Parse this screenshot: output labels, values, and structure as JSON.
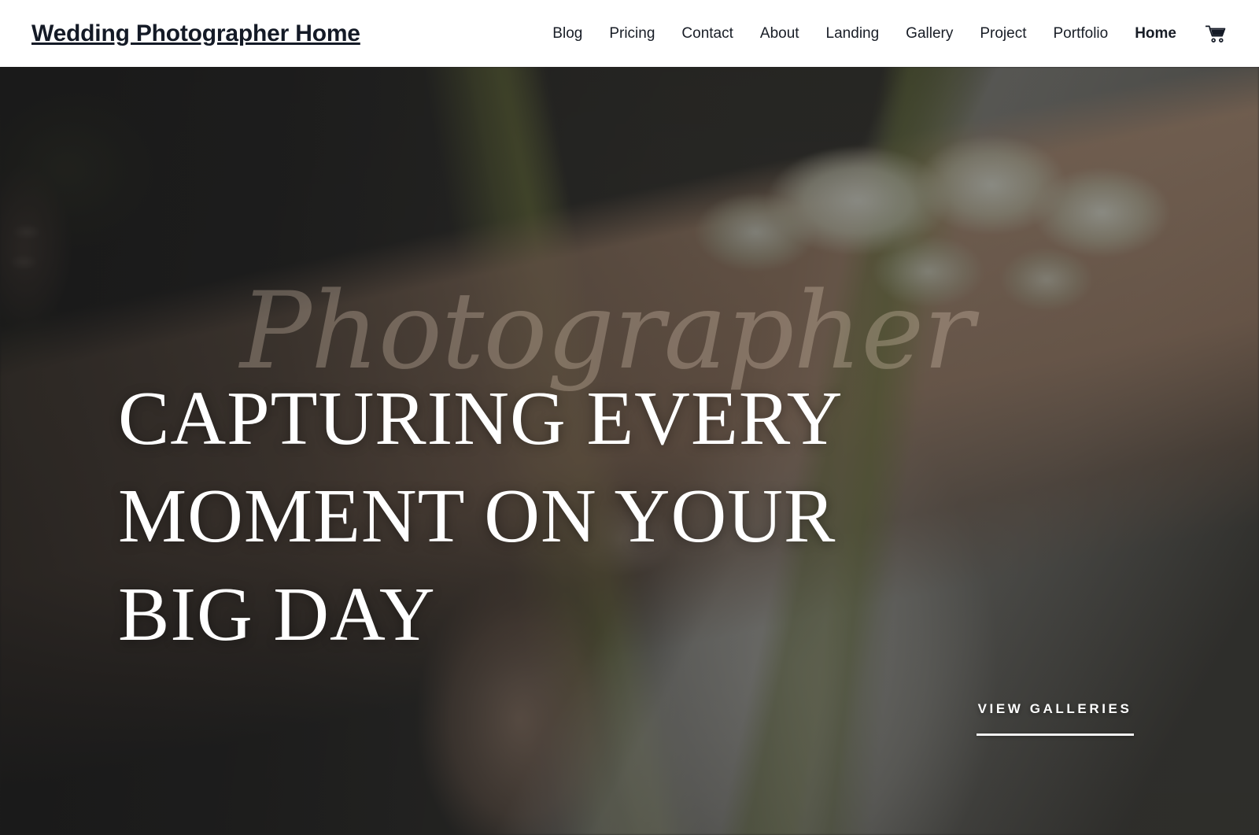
{
  "header": {
    "brand": "Wedding Photographer Home",
    "nav": [
      {
        "label": "Blog",
        "active": false
      },
      {
        "label": "Pricing",
        "active": false
      },
      {
        "label": "Contact",
        "active": false
      },
      {
        "label": "About",
        "active": false
      },
      {
        "label": "Landing",
        "active": false
      },
      {
        "label": "Gallery",
        "active": false
      },
      {
        "label": "Project",
        "active": false
      },
      {
        "label": "Portfolio",
        "active": false
      },
      {
        "label": "Home",
        "active": true
      }
    ],
    "cart_icon": "shopping-cart-icon",
    "background": "#ffffff",
    "text_color": "#141a26"
  },
  "hero": {
    "script_overlay": "Photographer",
    "title_lines": [
      "Capturing Every",
      "Moment On Your",
      "Big Day"
    ],
    "title_full": "CAPTURING EVERY MOMENT ON YOUR BIG DAY",
    "cta_label": "View Galleries",
    "colors": {
      "overlay_dark": "#2b2b2b",
      "script_tint": "#e2ceba",
      "title": "#ffffff",
      "cta_rule": "#f2f2f2"
    },
    "background_image_alt": "Bride holding a white bouquet, dark moody close-up"
  }
}
